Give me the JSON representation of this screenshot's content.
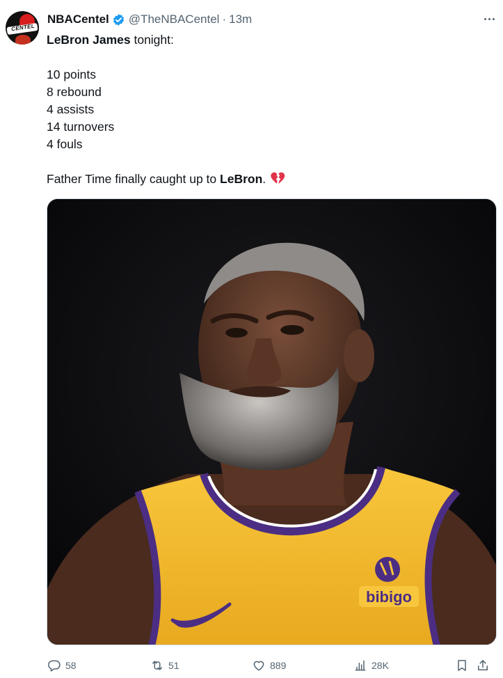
{
  "author": {
    "name": "NBACentel",
    "handle": "@TheNBACentel",
    "separator": "·",
    "time": "13m",
    "avatar_text": "CENTEL",
    "verified": true,
    "verified_color": "#1d9bf0"
  },
  "tweet": {
    "line1_bold": "LeBron James",
    "line1_rest": " tonight:",
    "stats": [
      "10 points",
      "8 rebound",
      "4 assists",
      "14 turnovers",
      "4 fouls"
    ],
    "closing_pre": "Father Time finally caught up to ",
    "closing_bold": "LeBron",
    "closing_post": ".",
    "emoji": "broken-heart-icon"
  },
  "media": {
    "jersey_sponsor": "bibigo",
    "jersey_color": "#f7c438",
    "jersey_trim": "#4b2e83"
  },
  "actions": {
    "replies": "58",
    "reposts": "51",
    "likes": "889",
    "views": "28K"
  }
}
